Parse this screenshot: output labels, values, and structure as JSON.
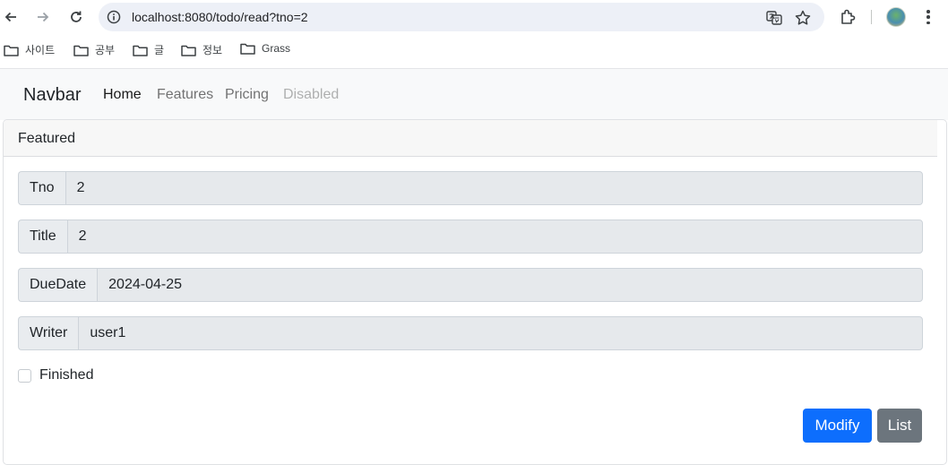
{
  "browser": {
    "url": "localhost:8080/todo/read?tno=2",
    "bookmarks": [
      "사이트",
      "공부",
      "글",
      "정보",
      "Grass"
    ]
  },
  "navbar": {
    "brand": "Navbar",
    "links": [
      {
        "label": "Home",
        "state": "active"
      },
      {
        "label": "Features",
        "state": "normal"
      },
      {
        "label": "Pricing",
        "state": "normal"
      },
      {
        "label": "Disabled",
        "state": "disabled"
      }
    ]
  },
  "card": {
    "header": "Featured",
    "fields": [
      {
        "label": "Tno",
        "value": "2"
      },
      {
        "label": "Title",
        "value": "2"
      },
      {
        "label": "DueDate",
        "value": "2024-04-25"
      },
      {
        "label": "Writer",
        "value": "user1"
      }
    ],
    "finished_label": "Finished",
    "finished_checked": false,
    "buttons": {
      "modify": "Modify",
      "list": "List"
    }
  },
  "colors": {
    "primary": "#0d6efd",
    "secondary": "#6c757d",
    "navbar_bg": "#f8f9fa"
  }
}
